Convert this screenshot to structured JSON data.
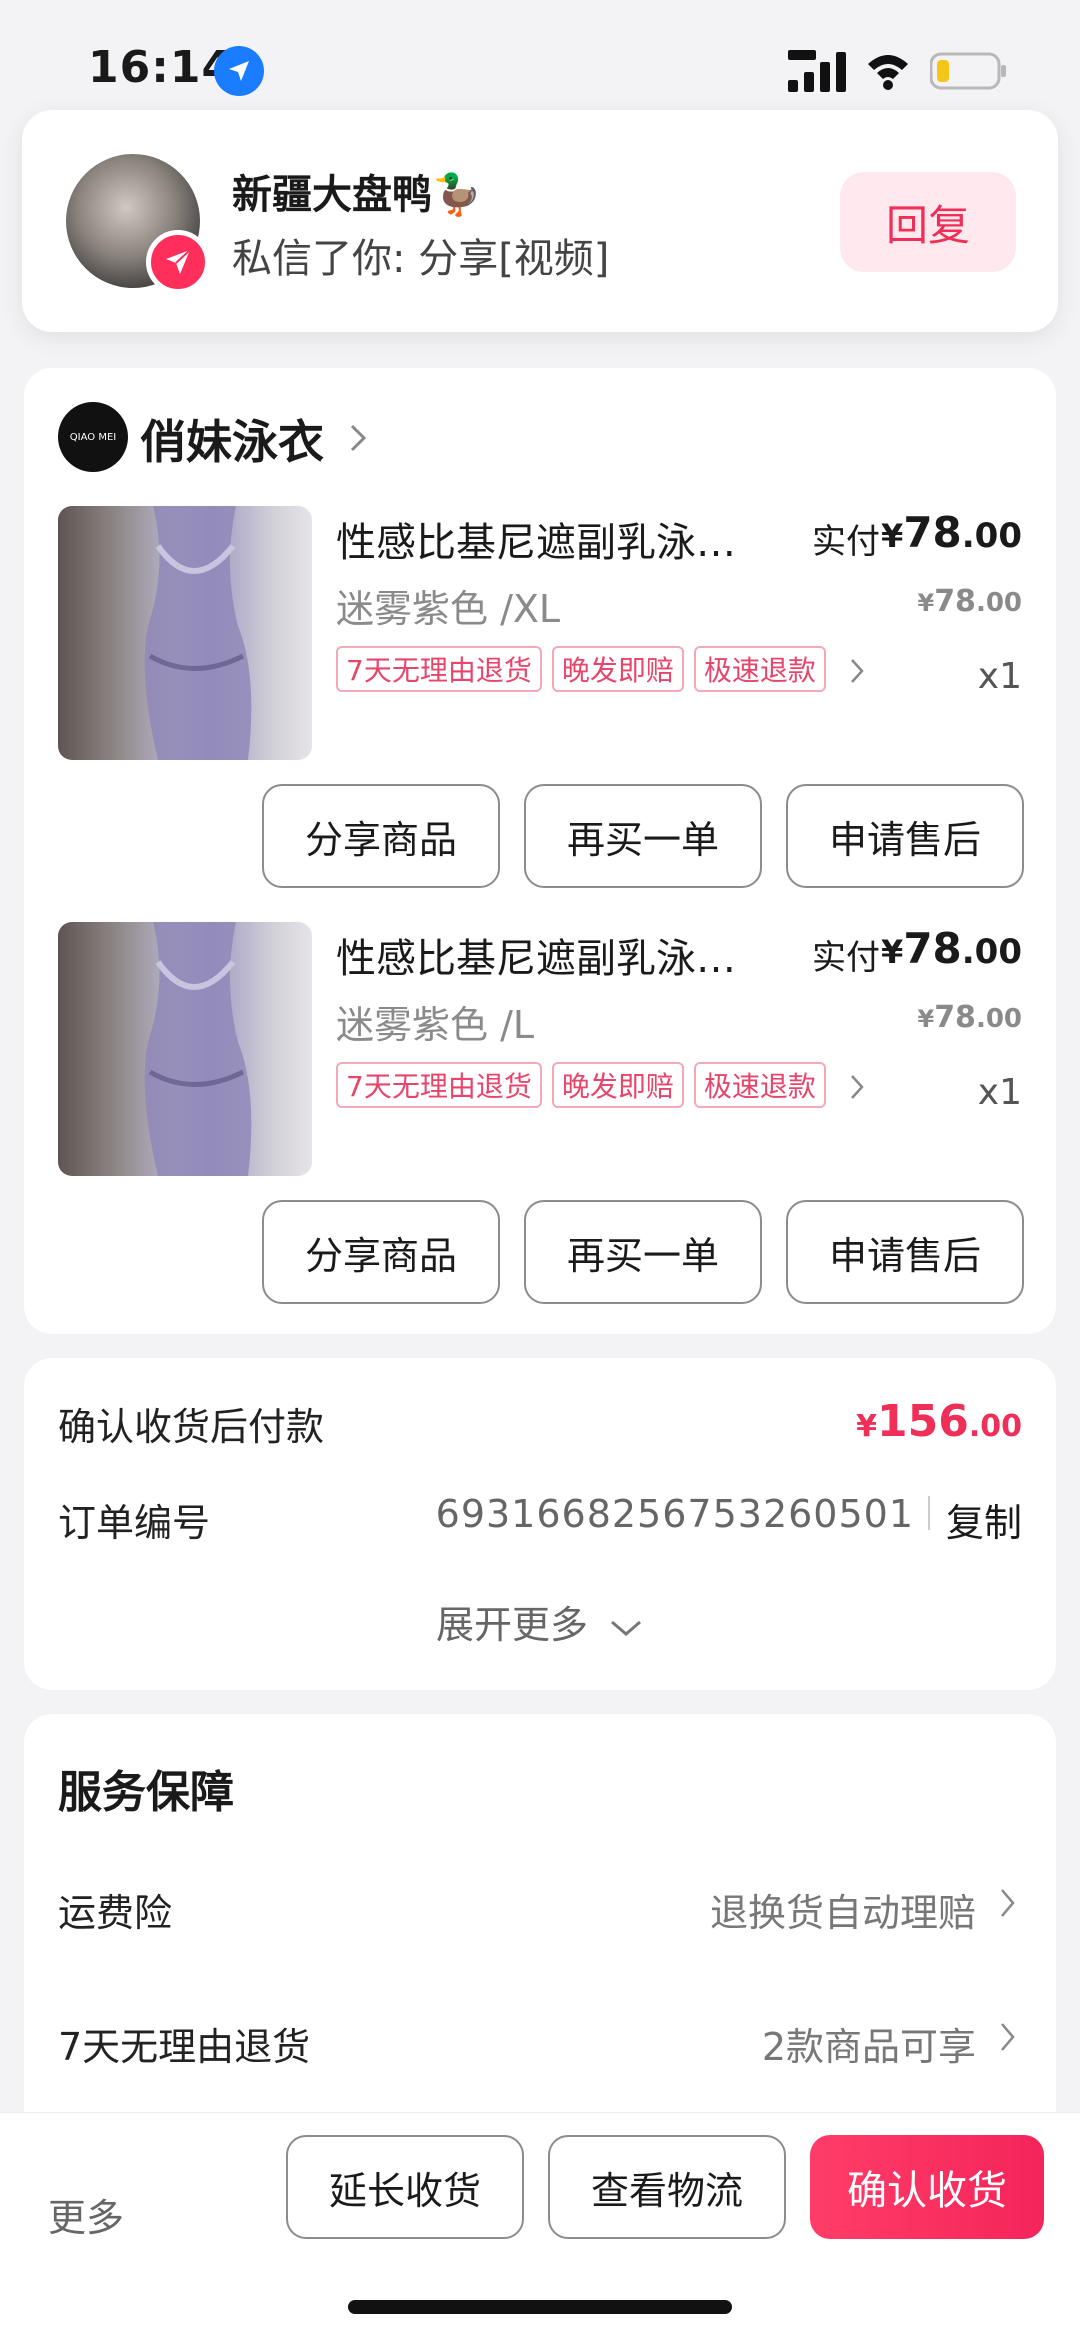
{
  "status_bar": {
    "time": "16:14"
  },
  "notification": {
    "sender": "新疆大盘鸭🦆",
    "message": "私信了你: 分享[视频]",
    "reply_label": "回复"
  },
  "shop": {
    "name": "俏妹泳衣",
    "logo_text": "QIAO MEI"
  },
  "items": [
    {
      "title": "性感比基尼遮副乳泳衣…",
      "paid_label": "实付",
      "paid_currency": "¥",
      "paid_int": "78",
      "paid_dec": ".00",
      "spec": "迷雾紫色 /XL",
      "orig_currency": "¥",
      "orig_int": "78",
      "orig_dec": ".00",
      "tags": [
        "7天无理由退货",
        "晚发即赔",
        "极速退款"
      ],
      "qty": "x1",
      "buttons": [
        "分享商品",
        "再买一单",
        "申请售后"
      ]
    },
    {
      "title": "性感比基尼遮副乳泳衣…",
      "paid_label": "实付",
      "paid_currency": "¥",
      "paid_int": "78",
      "paid_dec": ".00",
      "spec": "迷雾紫色 /L",
      "orig_currency": "¥",
      "orig_int": "78",
      "orig_dec": ".00",
      "tags": [
        "7天无理由退货",
        "晚发即赔",
        "极速退款"
      ],
      "qty": "x1",
      "buttons": [
        "分享商品",
        "再买一单",
        "申请售后"
      ]
    }
  ],
  "payment": {
    "label": "确认收货后付款",
    "currency": "¥",
    "amount_int": "156",
    "amount_dec": ".00",
    "order_label": "订单编号",
    "order_number": "6931668256753260501",
    "copy_label": "复制",
    "expand_label": "展开更多"
  },
  "services": {
    "title": "服务保障",
    "rows": [
      {
        "label": "运费险",
        "value": "退换货自动理赔"
      },
      {
        "label": "7天无理由退货",
        "value": "2款商品可享"
      }
    ]
  },
  "bottom_bar": {
    "more": "更多",
    "extend": "延长收货",
    "logistics": "查看物流",
    "confirm": "确认收货"
  },
  "colors": {
    "accent": "#ef2f57",
    "tag_border": "#f4a8b8",
    "location_blue": "#1a7cff"
  }
}
